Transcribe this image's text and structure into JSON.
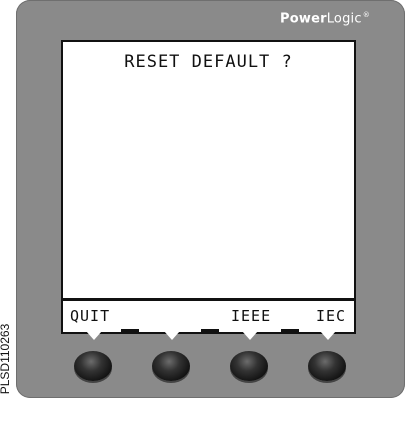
{
  "brand": {
    "name_bold": "Power",
    "name_light": "Logic",
    "mark": "®"
  },
  "screen": {
    "message": "RESET DEFAULT ?"
  },
  "softkeys": {
    "key1": "QUIT",
    "key2": "",
    "key3": "IEEE",
    "key4": "IEC"
  },
  "figure_code": "PLSD110263"
}
